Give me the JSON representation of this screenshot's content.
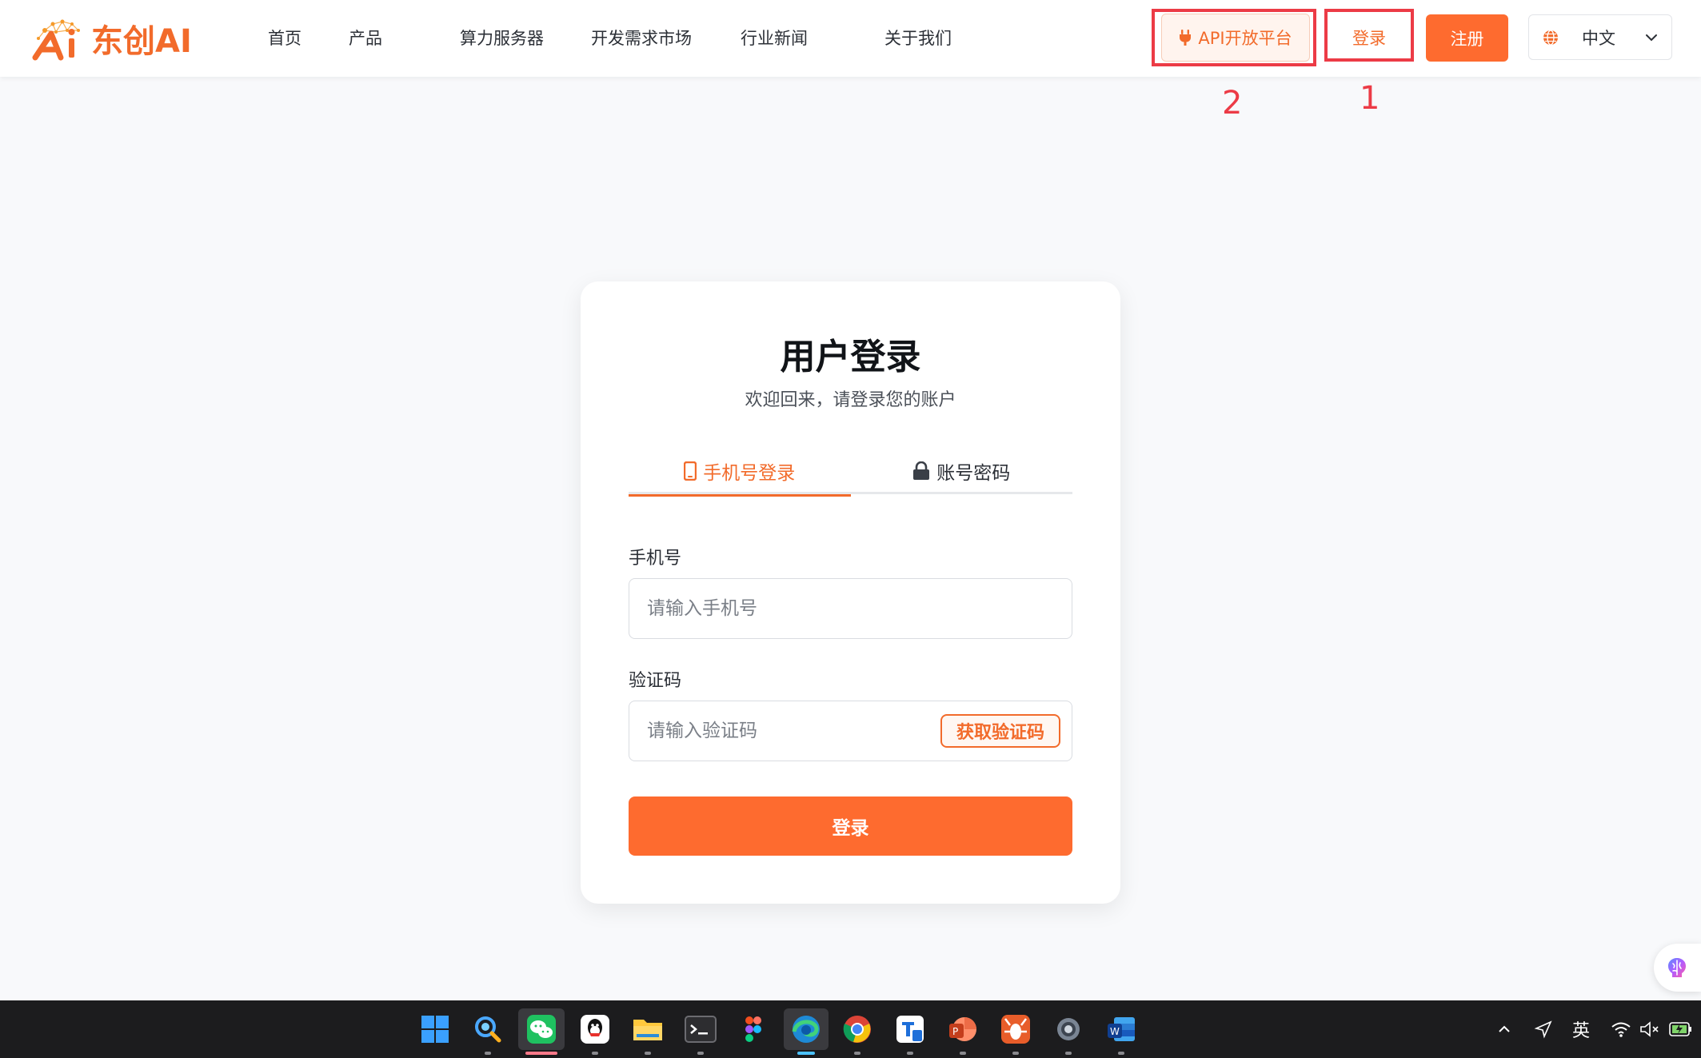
{
  "brand": {
    "name": "东创AI",
    "accent": "#f26b2b",
    "button_color": "#fe6b2f"
  },
  "nav": {
    "items": [
      {
        "label": "首页"
      },
      {
        "label": "产品"
      },
      {
        "label": "算力服务器"
      },
      {
        "label": "开发需求市场"
      },
      {
        "label": "行业新闻"
      },
      {
        "label": "关于我们"
      }
    ],
    "api_button": {
      "label": "API开放平台",
      "icon": "plug-icon"
    },
    "login_label": "登录",
    "register_label": "注册",
    "language": {
      "selected": "中文",
      "icon": "globe-icon"
    }
  },
  "annotations": [
    {
      "number": "1",
      "target": "登录",
      "color": "#ec3b46"
    },
    {
      "number": "2",
      "target": "API开放平台",
      "color": "#ec3b46"
    }
  ],
  "login_card": {
    "title": "用户登录",
    "subtitle": "欢迎回来，请登录您的账户",
    "tabs": [
      {
        "label": "手机号登录",
        "icon": "mobile-phone-icon",
        "active": true
      },
      {
        "label": "账号密码",
        "icon": "lock-icon",
        "active": false
      }
    ],
    "phone_label": "手机号",
    "phone_placeholder": "请输入手机号",
    "phone_value": "",
    "code_label": "验证码",
    "code_placeholder": "请输入验证码",
    "code_value": "",
    "get_code_label": "获取验证码",
    "submit_label": "登录"
  },
  "taskbar": {
    "apps": [
      "windows-start-icon",
      "search-icon",
      "wechat-icon",
      "qq-icon",
      "file-explorer-icon",
      "terminal-icon",
      "figma-icon",
      "edge-icon",
      "chrome-icon",
      "remote-desktop-icon",
      "powerpoint-icon",
      "lobster-app-icon",
      "settings-icon",
      "word-icon"
    ],
    "tray": {
      "input_method": "英"
    }
  }
}
